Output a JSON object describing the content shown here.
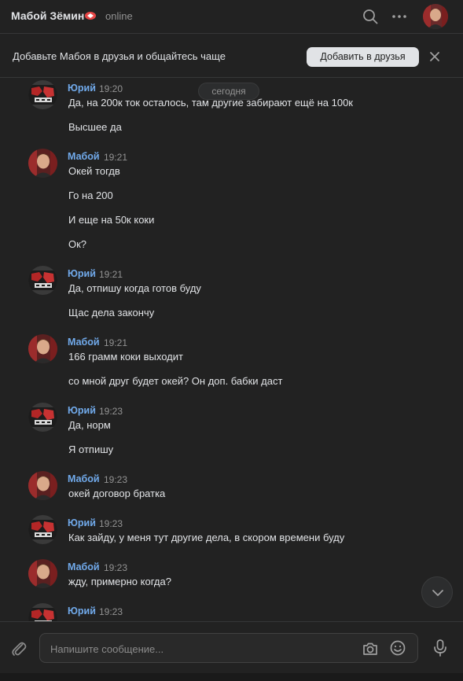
{
  "header": {
    "name": "Мабой Зёмин",
    "status": "online",
    "colors": {
      "background": "#222222",
      "accent": "#71aaeb",
      "vip_badge": "#e64646"
    }
  },
  "banner": {
    "text": "Добавьте Мабоя в друзья и общайтесь чаще",
    "add_button": "Добавить в друзья"
  },
  "history": {
    "date_label": "сегодня",
    "messages": [
      {
        "author": "Юрий",
        "time": "19:20",
        "avatar": "yuri",
        "lines": [
          "Да, на 200к ток осталось, там другие забирают ещё на 100к",
          "Высшее да"
        ]
      },
      {
        "author": "Мабой",
        "time": "19:21",
        "avatar": "maboy",
        "lines": [
          "Окей тогдв",
          "Го на 200",
          "И еще на 50к коки",
          "Ок?"
        ]
      },
      {
        "author": "Юрий",
        "time": "19:21",
        "avatar": "yuri",
        "lines": [
          "Да, отпишу когда готов буду",
          "Щас дела закончу"
        ]
      },
      {
        "author": "Мабой",
        "time": "19:21",
        "avatar": "maboy",
        "lines": [
          "166 грамм коки выходит",
          "со мной друг будет окей? Он доп. бабки даст"
        ]
      },
      {
        "author": "Юрий",
        "time": "19:23",
        "avatar": "yuri",
        "lines": [
          "Да, норм",
          "Я отпишу"
        ]
      },
      {
        "author": "Мабой",
        "time": "19:23",
        "avatar": "maboy",
        "lines": [
          "окей договор братка"
        ]
      },
      {
        "author": "Юрий",
        "time": "19:23",
        "avatar": "yuri",
        "lines": [
          "Как зайду, у меня тут другие дела, в скором времени буду"
        ]
      },
      {
        "author": "Мабой",
        "time": "19:23",
        "avatar": "maboy",
        "lines": [
          "жду, примерно когда?"
        ]
      },
      {
        "author": "Юрий",
        "time": "19:23",
        "avatar": "yuri",
        "lines": []
      }
    ]
  },
  "composer": {
    "placeholder": "Напишите сообщение..."
  },
  "icons": [
    "search-icon",
    "more-icon",
    "close-icon",
    "chevron-down-icon",
    "attach-icon",
    "camera-icon",
    "emoji-icon",
    "microphone-icon"
  ]
}
